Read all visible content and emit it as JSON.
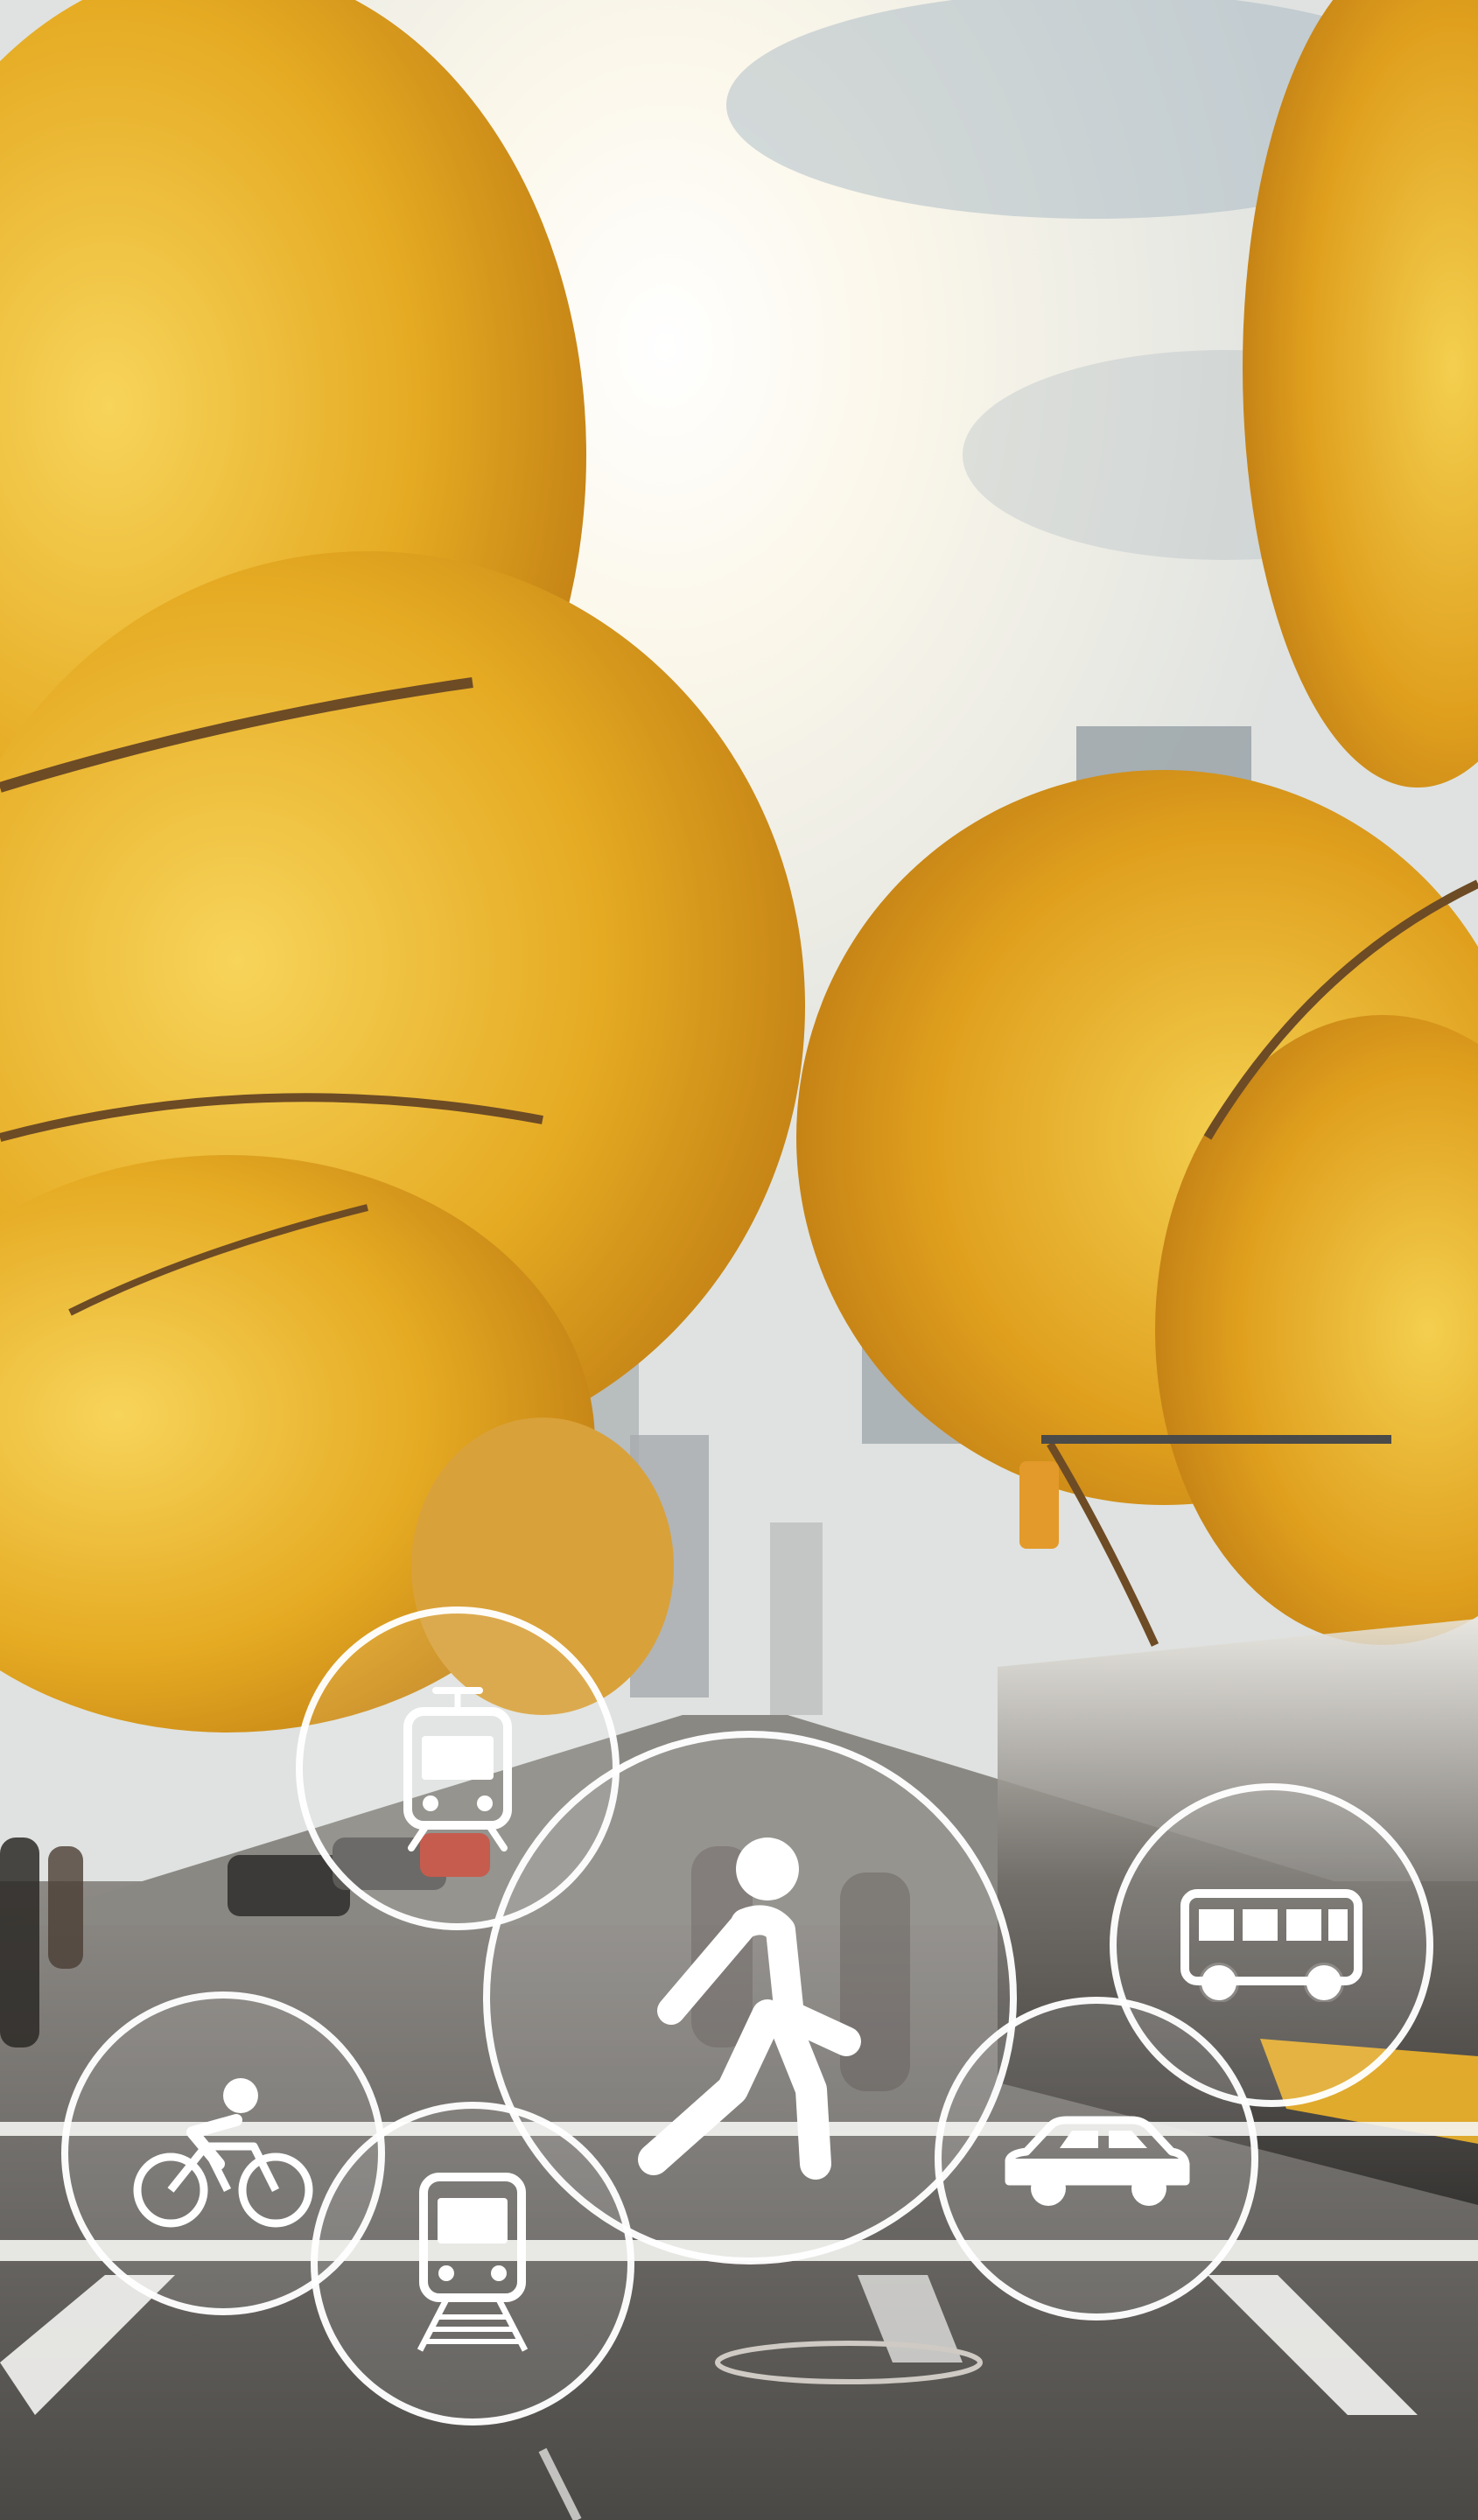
{
  "scene": {
    "description_colors": {
      "sky": "#eef0ef",
      "foliage_light": "#f0c33a",
      "foliage_dark": "#d89a1e",
      "road": "#5a5855",
      "crosswalk": "#f4f4f2",
      "bus_accent": "#f1b52a"
    }
  },
  "transport_modes": [
    {
      "id": "tram",
      "label": "",
      "icon": "tram-icon"
    },
    {
      "id": "walking",
      "label": "",
      "icon": "pedestrian-icon"
    },
    {
      "id": "bus",
      "label": "",
      "icon": "bus-icon"
    },
    {
      "id": "cycling",
      "label": "",
      "icon": "bicycle-icon"
    },
    {
      "id": "train",
      "label": "",
      "icon": "train-icon"
    },
    {
      "id": "car",
      "label": "",
      "icon": "car-icon"
    }
  ],
  "accent": {
    "icon_color": "#ffffff",
    "ring_color": "#ffffff"
  }
}
